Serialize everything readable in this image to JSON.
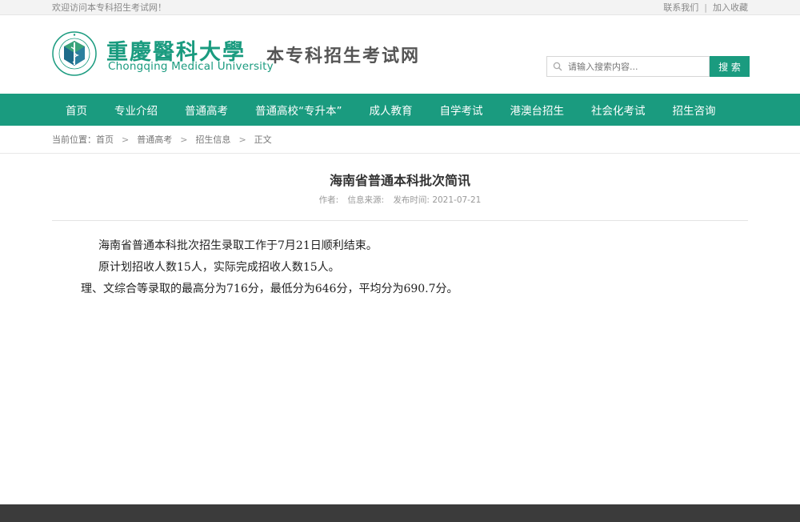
{
  "topbar": {
    "welcome": "欢迎访问本专科招生考试网！",
    "contact": "联系我们",
    "separator": "|",
    "favorite": "加入收藏"
  },
  "header": {
    "logo_cn": "重慶醫科大學",
    "logo_en": "Chongqing Medical University",
    "logo_ring_text": "重庆医科大学 Chongqing Medical University",
    "site_title": "本专科招生考试网",
    "search_placeholder": "请输入搜索内容...",
    "search_button": "搜 索"
  },
  "nav": {
    "items": [
      "首页",
      "专业介绍",
      "普通高考",
      "普通高校“专升本”",
      "成人教育",
      "自学考试",
      "港澳台招生",
      "社会化考试",
      "招生咨询"
    ]
  },
  "breadcrumb": {
    "prefix": "当前位置：",
    "items": [
      "首页",
      "普通高考",
      "招生信息",
      "正文"
    ],
    "arrow": ">"
  },
  "article": {
    "title": "海南省普通本科批次简讯",
    "author_label": "作者:",
    "source_label": "信息来源:",
    "date_label": "发布时间: 2021-07-21",
    "paragraphs": [
      "海南省普通本科批次招生录取工作于7月21日顺利结束。",
      "原计划招收人数15人，实际完成招收人数15人。",
      "理、文综合等录取的最高分为716分，最低分为646分，平均分为690.7分。"
    ]
  },
  "footer": {
    "text": ""
  },
  "colors": {
    "brand": "#1a9b7f",
    "footer_bg": "#3b3b3b"
  }
}
